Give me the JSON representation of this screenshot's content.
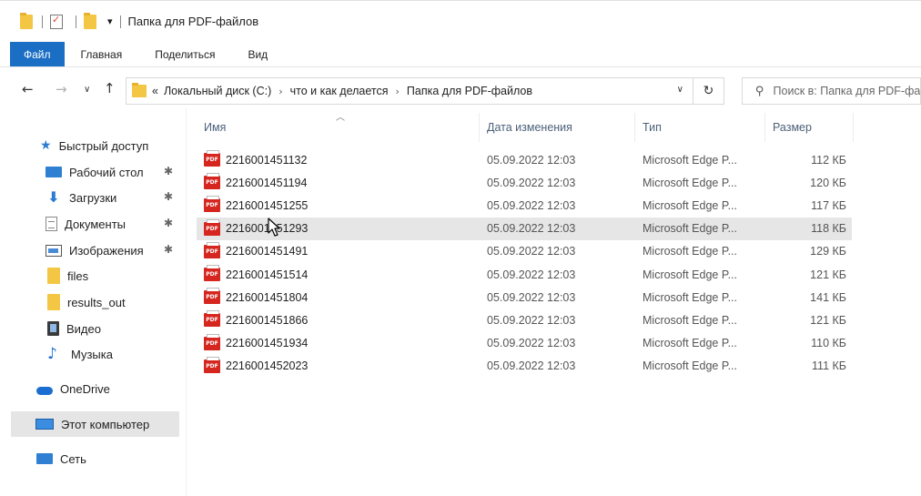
{
  "window": {
    "title": "Папка для PDF-файлов"
  },
  "ribbon": {
    "tabs": [
      "Файл",
      "Главная",
      "Поделиться",
      "Вид"
    ]
  },
  "address": {
    "prefix": "«",
    "crumbs": [
      "Локальный диск (C:)",
      "что и как делается",
      "Папка для PDF-файлов"
    ]
  },
  "search": {
    "placeholder": "Поиск в: Папка для PDF-файлов"
  },
  "sidebar": {
    "quick_access": "Быстрый доступ",
    "items": [
      {
        "label": "Рабочий стол",
        "icon": "desktop-icon",
        "pinned": true
      },
      {
        "label": "Загрузки",
        "icon": "download-icon",
        "pinned": true
      },
      {
        "label": "Документы",
        "icon": "documents-icon",
        "pinned": true
      },
      {
        "label": "Изображения",
        "icon": "pictures-icon",
        "pinned": true
      },
      {
        "label": "files",
        "icon": "folder-icon",
        "pinned": false
      },
      {
        "label": "results_out",
        "icon": "folder-icon",
        "pinned": false
      },
      {
        "label": "Видео",
        "icon": "video-icon",
        "pinned": false
      },
      {
        "label": "Музыка",
        "icon": "music-icon",
        "pinned": false
      }
    ],
    "onedrive": "OneDrive",
    "this_pc": "Этот компьютер",
    "network": "Сеть"
  },
  "columns": {
    "name": "Имя",
    "date": "Дата изменения",
    "type": "Тип",
    "size": "Размер"
  },
  "files": [
    {
      "name": "2216001451132",
      "date": "05.09.2022 12:03",
      "type": "Microsoft Edge P...",
      "size": "112 КБ"
    },
    {
      "name": "2216001451194",
      "date": "05.09.2022 12:03",
      "type": "Microsoft Edge P...",
      "size": "120 КБ"
    },
    {
      "name": "2216001451255",
      "date": "05.09.2022 12:03",
      "type": "Microsoft Edge P...",
      "size": "117 КБ"
    },
    {
      "name": "2216001451293",
      "date": "05.09.2022 12:03",
      "type": "Microsoft Edge P...",
      "size": "118 КБ"
    },
    {
      "name": "2216001451491",
      "date": "05.09.2022 12:03",
      "type": "Microsoft Edge P...",
      "size": "129 КБ"
    },
    {
      "name": "2216001451514",
      "date": "05.09.2022 12:03",
      "type": "Microsoft Edge P...",
      "size": "121 КБ"
    },
    {
      "name": "2216001451804",
      "date": "05.09.2022 12:03",
      "type": "Microsoft Edge P...",
      "size": "141 КБ"
    },
    {
      "name": "2216001451866",
      "date": "05.09.2022 12:03",
      "type": "Microsoft Edge P...",
      "size": "121 КБ"
    },
    {
      "name": "2216001451934",
      "date": "05.09.2022 12:03",
      "type": "Microsoft Edge P...",
      "size": "110 КБ"
    },
    {
      "name": "2216001452023",
      "date": "05.09.2022 12:03",
      "type": "Microsoft Edge P...",
      "size": "111 КБ"
    }
  ],
  "file_icon_label": "PDF",
  "colors": {
    "accent": "#1a6ec4",
    "pdf_red": "#d5261f",
    "folder_yellow": "#f3c744"
  }
}
